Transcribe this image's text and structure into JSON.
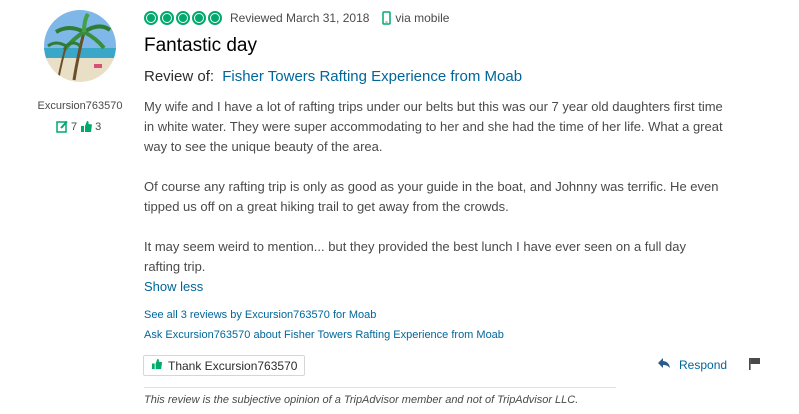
{
  "reviewer": {
    "username": "Excursion763570",
    "reviews_count": "7",
    "helpful_votes": "3",
    "avatar_icon": "palm-beach-avatar"
  },
  "review": {
    "rating": 5,
    "rating_color": "#00aa6c",
    "reviewed_date": "Reviewed March 31, 2018",
    "via": "via mobile",
    "title": "Fantastic day",
    "review_of_label": "Review of:",
    "attraction_link": "Fisher Towers Rafting Experience from Moab",
    "paragraphs": [
      "My wife and I have a lot of rafting trips under our belts but this was our 7 year old daughters first time in white water. They were super accommodating to her and she had the time of her life. What a great way to see the unique beauty of the area.",
      "Of course any rafting trip is only as good as your guide in the boat, and Johnny was terrific. He even tipped us off on a great hiking trail to get away from the crowds.",
      "It may seem weird to mention... but they provided the best lunch I have ever seen on a full day rafting trip."
    ],
    "show_less": "Show less"
  },
  "links": {
    "see_all": "See all 3 reviews by Excursion763570 for Moab",
    "ask": "Ask Excursion763570 about Fisher Towers Rafting Experience from Moab"
  },
  "actions": {
    "thank": "Thank Excursion763570",
    "respond": "Respond"
  },
  "disclaimer": "This review is the subjective opinion of a TripAdvisor member and not of TripAdvisor LLC.",
  "colors": {
    "link": "#006699",
    "accent_green": "#00aa6c"
  }
}
